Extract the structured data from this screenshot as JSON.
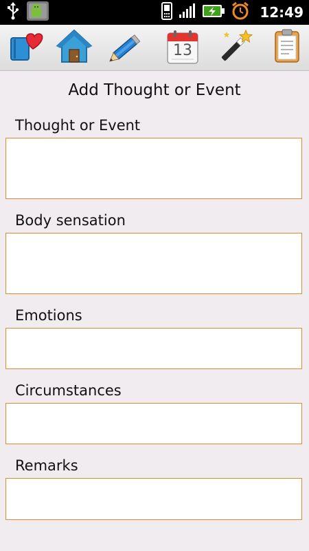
{
  "status_bar": {
    "time": "12:49",
    "icons": [
      "usb-icon",
      "android-notification-icon",
      "phone-icon",
      "signal-icon",
      "battery-charging-icon",
      "alarm-clock-icon"
    ]
  },
  "toolbar": {
    "buttons": [
      {
        "name": "diary-heart-icon"
      },
      {
        "name": "home-icon"
      },
      {
        "name": "pencil-icon"
      },
      {
        "name": "calendar-icon",
        "day": "13"
      },
      {
        "name": "magic-wand-icon"
      },
      {
        "name": "clipboard-icon"
      }
    ]
  },
  "form": {
    "title": "Add Thought or Event",
    "fields": [
      {
        "label": "Thought or Event",
        "value": ""
      },
      {
        "label": "Body sensation",
        "value": ""
      },
      {
        "label": "Emotions",
        "value": ""
      },
      {
        "label": "Circumstances",
        "value": ""
      },
      {
        "label": "Remarks",
        "value": ""
      }
    ]
  },
  "colors": {
    "field_border": "#e08a2e",
    "background": "#f0ecf0"
  }
}
